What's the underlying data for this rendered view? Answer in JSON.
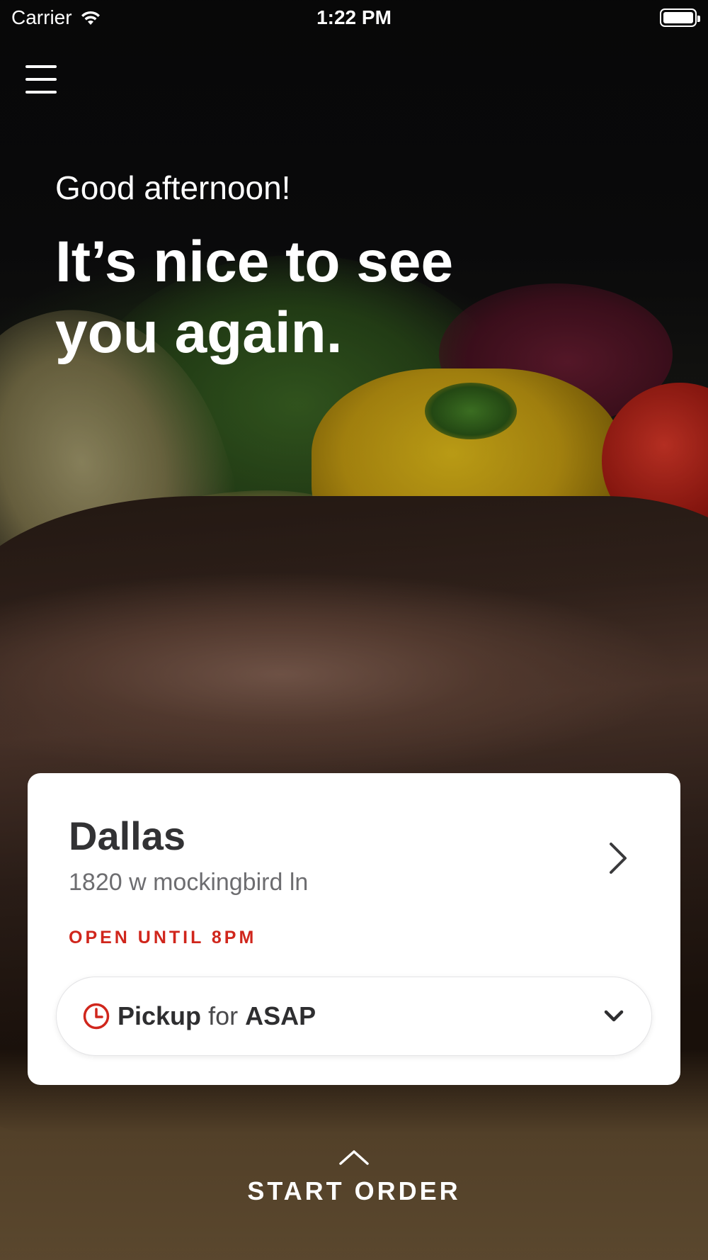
{
  "status_bar": {
    "carrier": "Carrier",
    "time": "1:22 PM",
    "battery_level": 1.0
  },
  "header": {
    "menu_icon": "hamburger-menu-icon"
  },
  "hero": {
    "greeting": "Good afternoon!",
    "headline": "It’s nice to see you again."
  },
  "location_card": {
    "city": "Dallas",
    "address": "1820 w mockingbird ln",
    "hours": "OPEN UNTIL 8PM",
    "hours_color": "#d0261c",
    "navigate_icon": "chevron-right-icon",
    "order_mode": {
      "icon": "clock-icon",
      "method": "Pickup",
      "connector": "for",
      "time": "ASAP",
      "dropdown_icon": "chevron-down-icon"
    }
  },
  "footer": {
    "start_order_icon": "caret-up-icon",
    "start_order_label": "START ORDER"
  }
}
